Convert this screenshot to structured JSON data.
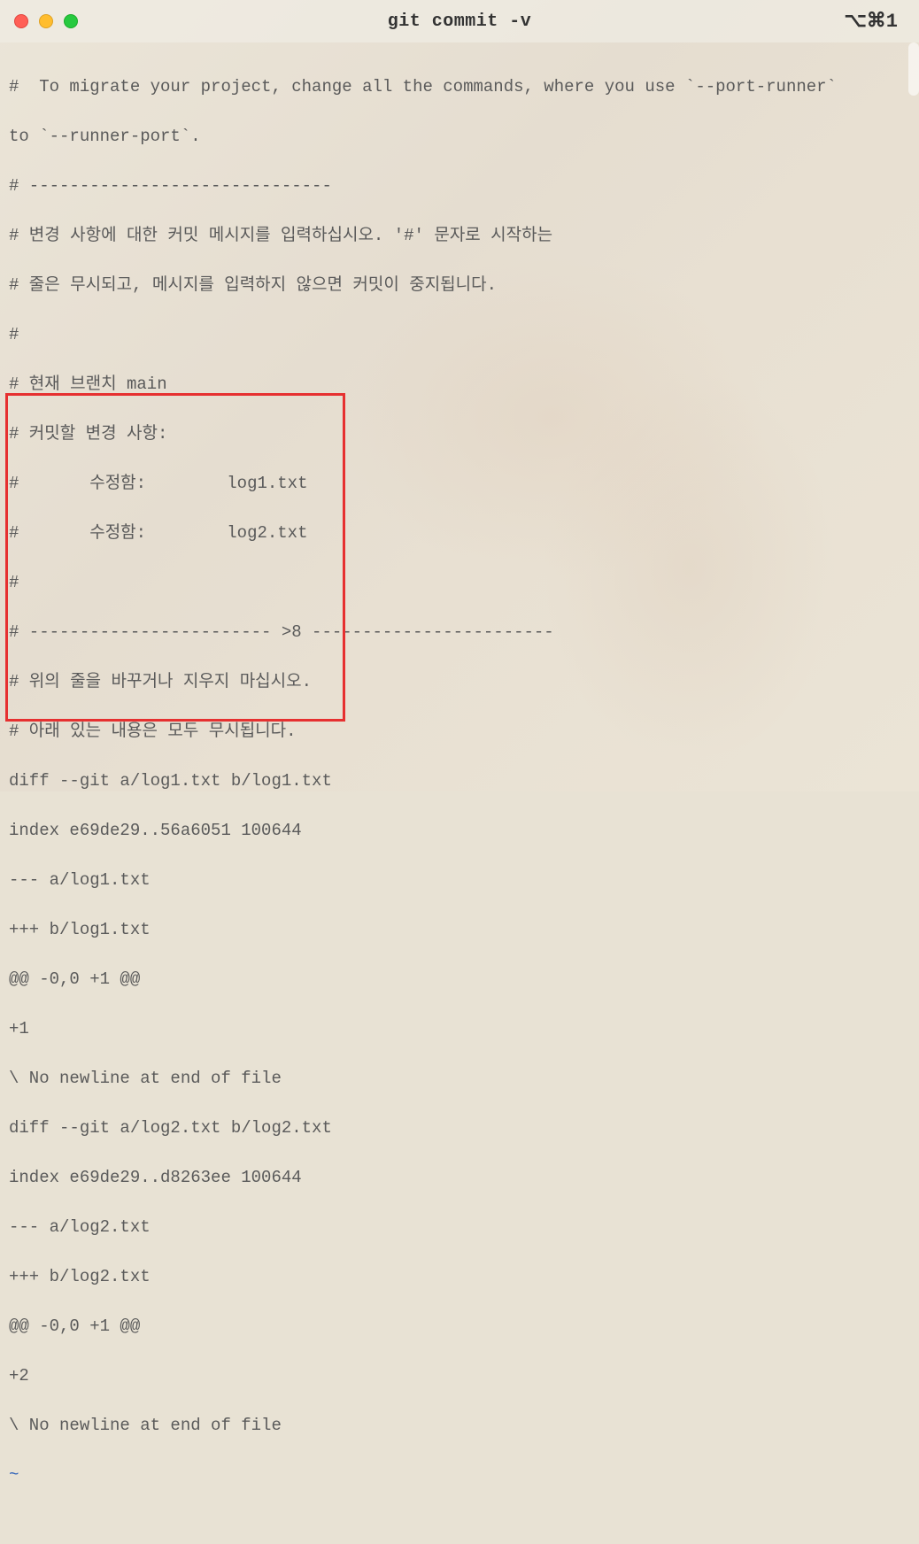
{
  "titlebar": {
    "title": "git commit -v",
    "shortcut": "⌥⌘1"
  },
  "content": {
    "l1": "#  To migrate your project, change all the commands, where you use `--port-runner`",
    "l2": "to `--runner-port`.",
    "l3": "# ------------------------------",
    "l4": "# 변경 사항에 대한 커밋 메시지를 입력하십시오. '#' 문자로 시작하는",
    "l5": "# 줄은 무시되고, 메시지를 입력하지 않으면 커밋이 중지됩니다.",
    "l6": "#",
    "l7": "# 현재 브랜치 main",
    "l8": "# 커밋할 변경 사항:",
    "l9": "#       수정함:        log1.txt",
    "l10": "#       수정함:        log2.txt",
    "l11": "#",
    "l12": "# ------------------------ >8 ------------------------",
    "l13": "# 위의 줄을 바꾸거나 지우지 마십시오.",
    "l14": "# 아래 있는 내용은 모두 무시됩니다.",
    "l15": "diff --git a/log1.txt b/log1.txt",
    "l16": "index e69de29..56a6051 100644",
    "l17": "--- a/log1.txt",
    "l18": "+++ b/log1.txt",
    "l19": "@@ -0,0 +1 @@",
    "l20": "+1",
    "l21": "\\ No newline at end of file",
    "l22": "diff --git a/log2.txt b/log2.txt",
    "l23": "index e69de29..d8263ee 100644",
    "l24": "--- a/log2.txt",
    "l25": "+++ b/log2.txt",
    "l26": "@@ -0,0 +1 @@",
    "l27": "+2",
    "l28": "\\ No newline at end of file",
    "l29": "~"
  }
}
